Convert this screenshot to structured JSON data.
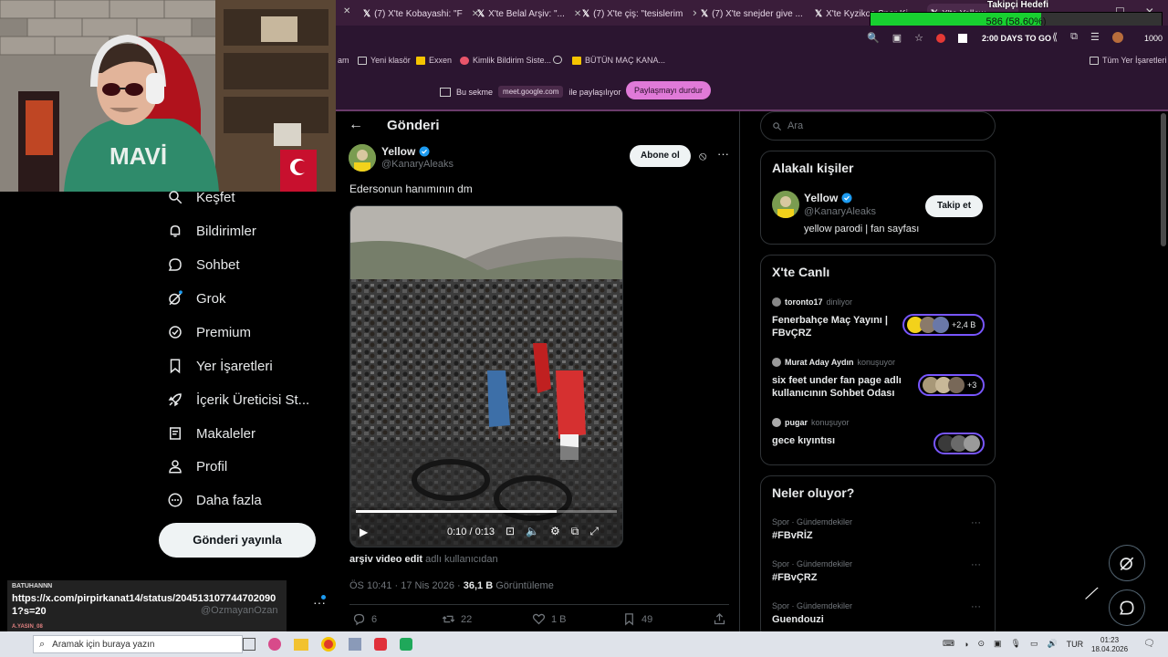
{
  "browser": {
    "tabs": [
      {
        "label": "(7) X'te Kobayashi: \"F"
      },
      {
        "label": "X'te Belal Arşiv: \"..."
      },
      {
        "label": "(7) X'te çiş: \"tesislerim"
      },
      {
        "label": "(7) X'te snejder give ..."
      },
      {
        "label": "X'te Kyzikos Spor Ki..."
      },
      {
        "label": "X'te Yellow"
      }
    ],
    "toolbar_text": "2:00 DAYS TO GO",
    "toolbar_count": "1000",
    "bookmarks": [
      {
        "label": "am"
      },
      {
        "label": "Yeni klasör"
      },
      {
        "label": "Exxen"
      },
      {
        "label": "Kimlik Bildirim Siste..."
      },
      {
        "label": "BÜTÜN MAÇ KANA..."
      },
      {
        "label": "Tüm Yer İşaretleri"
      }
    ],
    "share": {
      "prefix": "Bu sekme",
      "domain": "meet.google.com",
      "suffix": "ile paylaşılıyor",
      "stop_label": "Paylaşmayı durdur"
    }
  },
  "goal": {
    "title": "Takipçi Hedefi",
    "text": "586 (58.60%)",
    "fraction": 0.586
  },
  "nav": {
    "items": [
      {
        "label": "Keşfet",
        "icon": "search-icon"
      },
      {
        "label": "Bildirimler",
        "icon": "bell-icon"
      },
      {
        "label": "Sohbet",
        "icon": "chat-icon"
      },
      {
        "label": "Grok",
        "icon": "grok-icon"
      },
      {
        "label": "Premium",
        "icon": "premium-icon"
      },
      {
        "label": "Yer İşaretleri",
        "icon": "bookmark-icon"
      },
      {
        "label": "İçerik Üreticisi St...",
        "icon": "rocket-icon"
      },
      {
        "label": "Makaleler",
        "icon": "article-icon"
      },
      {
        "label": "Profil",
        "icon": "person-icon"
      },
      {
        "label": "Daha fazla",
        "icon": "more-icon"
      }
    ],
    "post_button": "Gönderi yayınla"
  },
  "chat": {
    "user": "BATUHANNN",
    "message": "https://x.com/pirpirkanat14/status/2045131077447020901?s=20",
    "next_user": "A.YASIN_08",
    "account_handle": "@OzmayanOzan"
  },
  "post": {
    "header": "Gönderi",
    "author_name": "Yellow",
    "author_handle": "@KanaryAleaks",
    "subscribe_label": "Abone ol",
    "text": "Edersonun hanımının dm",
    "video_time": "0:10 / 0:13",
    "video_progress": 0.77,
    "source_name": "arşiv video edit",
    "source_suffix": "adlı kullanıcıdan",
    "timestamp": "ÖS 10:41 · 17 Nis 2026 ·",
    "views_count": "36,1 B",
    "views_label": "Görüntüleme",
    "replies": "6",
    "reposts": "22",
    "likes": "1 B",
    "bookmarks": "49"
  },
  "right": {
    "search_placeholder": "Ara",
    "related": {
      "title": "Alakalı kişiler",
      "name": "Yellow",
      "handle": "@KanaryAleaks",
      "follow_label": "Takip et",
      "bio": "yellow parodi | fan sayfası"
    },
    "live": {
      "title": "X'te Canlı",
      "items": [
        {
          "host": "toronto17",
          "status": "dinliyor",
          "title": "Fenerbahçe Maç Yayını | FBvÇRZ",
          "count": "+2,4 B"
        },
        {
          "host": "Murat Aday Aydın",
          "status": "konuşuyor",
          "title": "six feet under fan page adlı kullanıcının Sohbet Odası",
          "count": "+3"
        },
        {
          "host": "pugar",
          "status": "konuşuyor",
          "title": "gece kıyıntısı",
          "count": ""
        }
      ]
    },
    "trends": {
      "title": "Neler oluyor?",
      "items": [
        {
          "category": "Spor · Gündemdekiler",
          "tag": "#FBvRİZ"
        },
        {
          "category": "Spor · Gündemdekiler",
          "tag": "#FBvÇRZ"
        },
        {
          "category": "Spor · Gündemdekiler",
          "tag": "Guendouzi"
        }
      ]
    }
  },
  "taskbar": {
    "search_placeholder": "Aramak için buraya yazın",
    "lang": "TUR",
    "time": "01:23",
    "date": "18.04.2026"
  },
  "colors": {
    "accent": "#1d9bf0",
    "goal_fill": "#18d030",
    "share_btn": "#e07ad8",
    "live_border": "#7856ff"
  }
}
